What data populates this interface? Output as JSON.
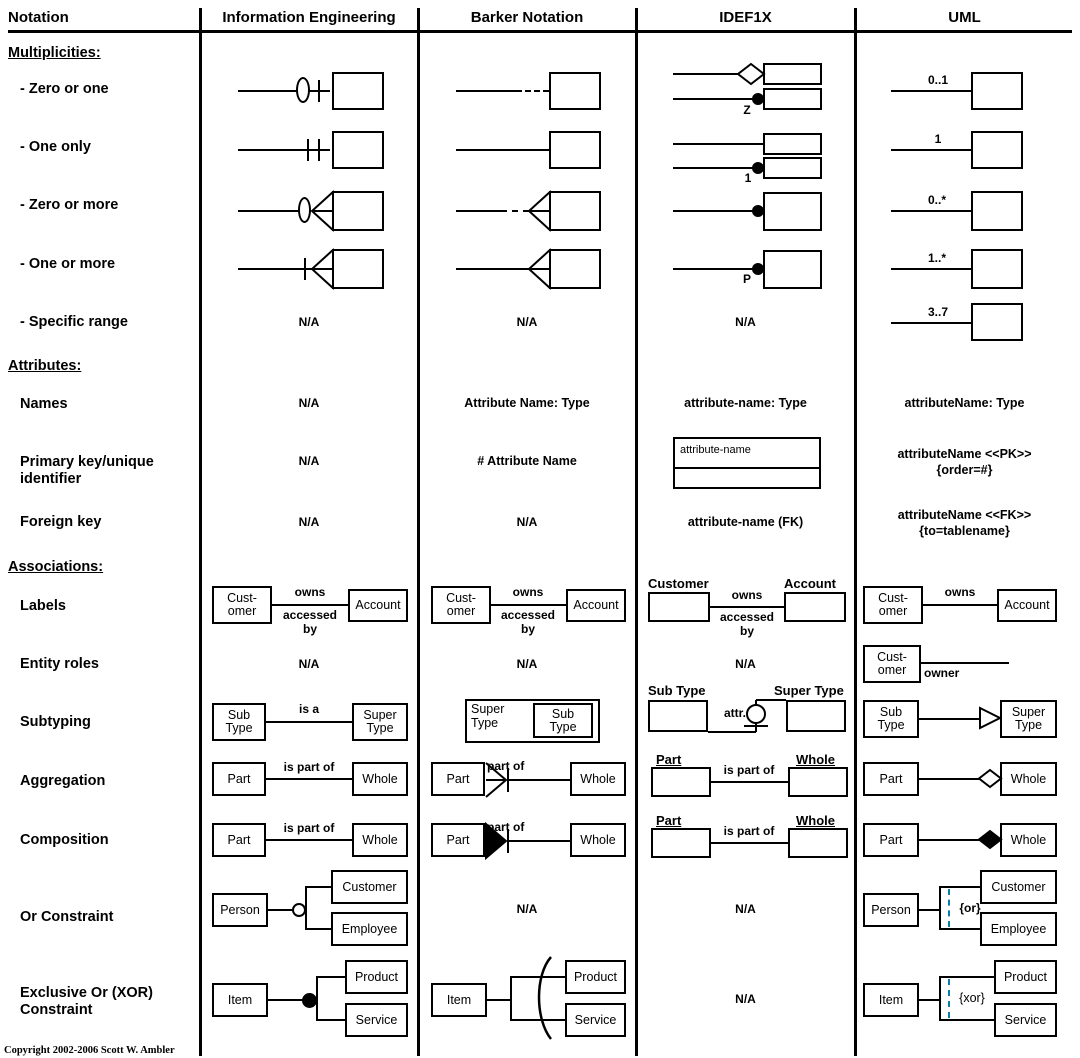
{
  "table": {
    "columns": [
      {
        "id": "notation",
        "label": "Notation"
      },
      {
        "id": "ie",
        "label": "Information Engineering"
      },
      {
        "id": "barker",
        "label": "Barker Notation"
      },
      {
        "id": "idef1x",
        "label": "IDEF1X"
      },
      {
        "id": "uml",
        "label": "UML"
      }
    ],
    "sections": [
      {
        "id": "multiplicities",
        "label": "Multiplicities:"
      },
      {
        "id": "attributes",
        "label": "Attributes:"
      },
      {
        "id": "associations",
        "label": "Associations:"
      }
    ],
    "rows": [
      {
        "id": "zero-or-one",
        "label": "- Zero or one"
      },
      {
        "id": "one-only",
        "label": "- One only"
      },
      {
        "id": "zero-or-more",
        "label": "- Zero or more"
      },
      {
        "id": "one-or-more",
        "label": "- One or more"
      },
      {
        "id": "specific-range",
        "label": "- Specific range"
      },
      {
        "id": "names",
        "label": "Names"
      },
      {
        "id": "primary-key",
        "label": "Primary key/unique identifier"
      },
      {
        "id": "foreign-key",
        "label": "Foreign key"
      },
      {
        "id": "labels",
        "label": "Labels"
      },
      {
        "id": "entity-roles",
        "label": "Entity roles"
      },
      {
        "id": "subtyping",
        "label": "Subtyping"
      },
      {
        "id": "aggregation",
        "label": "Aggregation"
      },
      {
        "id": "composition",
        "label": "Composition"
      },
      {
        "id": "or-constraint",
        "label": "Or Constraint"
      },
      {
        "id": "xor-constraint",
        "label": "Exclusive Or (XOR) Constraint"
      }
    ]
  },
  "na": "N/A",
  "multiplicities": {
    "idef1x": {
      "zero_or_one_marker": "Z",
      "one_only_marker": "1",
      "one_or_more_marker": "P"
    },
    "uml": {
      "zero_or_one": "0..1",
      "one_only": "1",
      "zero_or_more": "0..*",
      "one_or_more": "1..*",
      "specific_range": "3..7"
    }
  },
  "attributes": {
    "names": {
      "ie": "N/A",
      "barker": "Attribute Name: Type",
      "idef1x": "attribute-name: Type",
      "uml": "attributeName: Type"
    },
    "primary_key": {
      "ie": "N/A",
      "barker": "# Attribute Name",
      "idef1x_box_text": "attribute-name",
      "uml_line1": "attributeName <<PK>>",
      "uml_line2": "{order=#}"
    },
    "foreign_key": {
      "ie": "N/A",
      "barker": "N/A",
      "idef1x": "attribute-name (FK)",
      "uml_line1": "attributeName <<FK>>",
      "uml_line2": "{to=tablename}"
    }
  },
  "associations": {
    "labels": {
      "customer_l1": "Cust-",
      "customer_l2": "omer",
      "customer_full": "Customer",
      "account": "Account",
      "owns": "owns",
      "accessed_l1": "accessed",
      "accessed_l2": "by"
    },
    "entity_roles": {
      "customer_l1": "Cust-",
      "customer_l2": "omer",
      "owner": "owner"
    },
    "subtyping": {
      "sub_l1": "Sub",
      "sub_l2": "Type",
      "super_l1": "Super",
      "super_l2": "Type",
      "sub_full": "Sub Type",
      "super_full": "Super Type",
      "ie_label": "is a",
      "idef1x_attr": "attr."
    },
    "aggregation": {
      "part": "Part",
      "whole": "Whole",
      "label": "is part of",
      "barker_label": "part of"
    },
    "composition": {
      "part": "Part",
      "whole": "Whole",
      "label": "is part of",
      "barker_label": "part of"
    },
    "or_constraint": {
      "person": "Person",
      "customer": "Customer",
      "employee": "Employee",
      "uml_label": "{or}"
    },
    "xor_constraint": {
      "item": "Item",
      "product": "Product",
      "service": "Service",
      "uml_label": "{xor}"
    }
  },
  "footer": {
    "copyright": "Copyright 2002-2006 Scott W. Ambler"
  },
  "colors": {
    "ink": "#000000",
    "paper": "#ffffff",
    "constraint_dash": "#0a7ea4"
  }
}
